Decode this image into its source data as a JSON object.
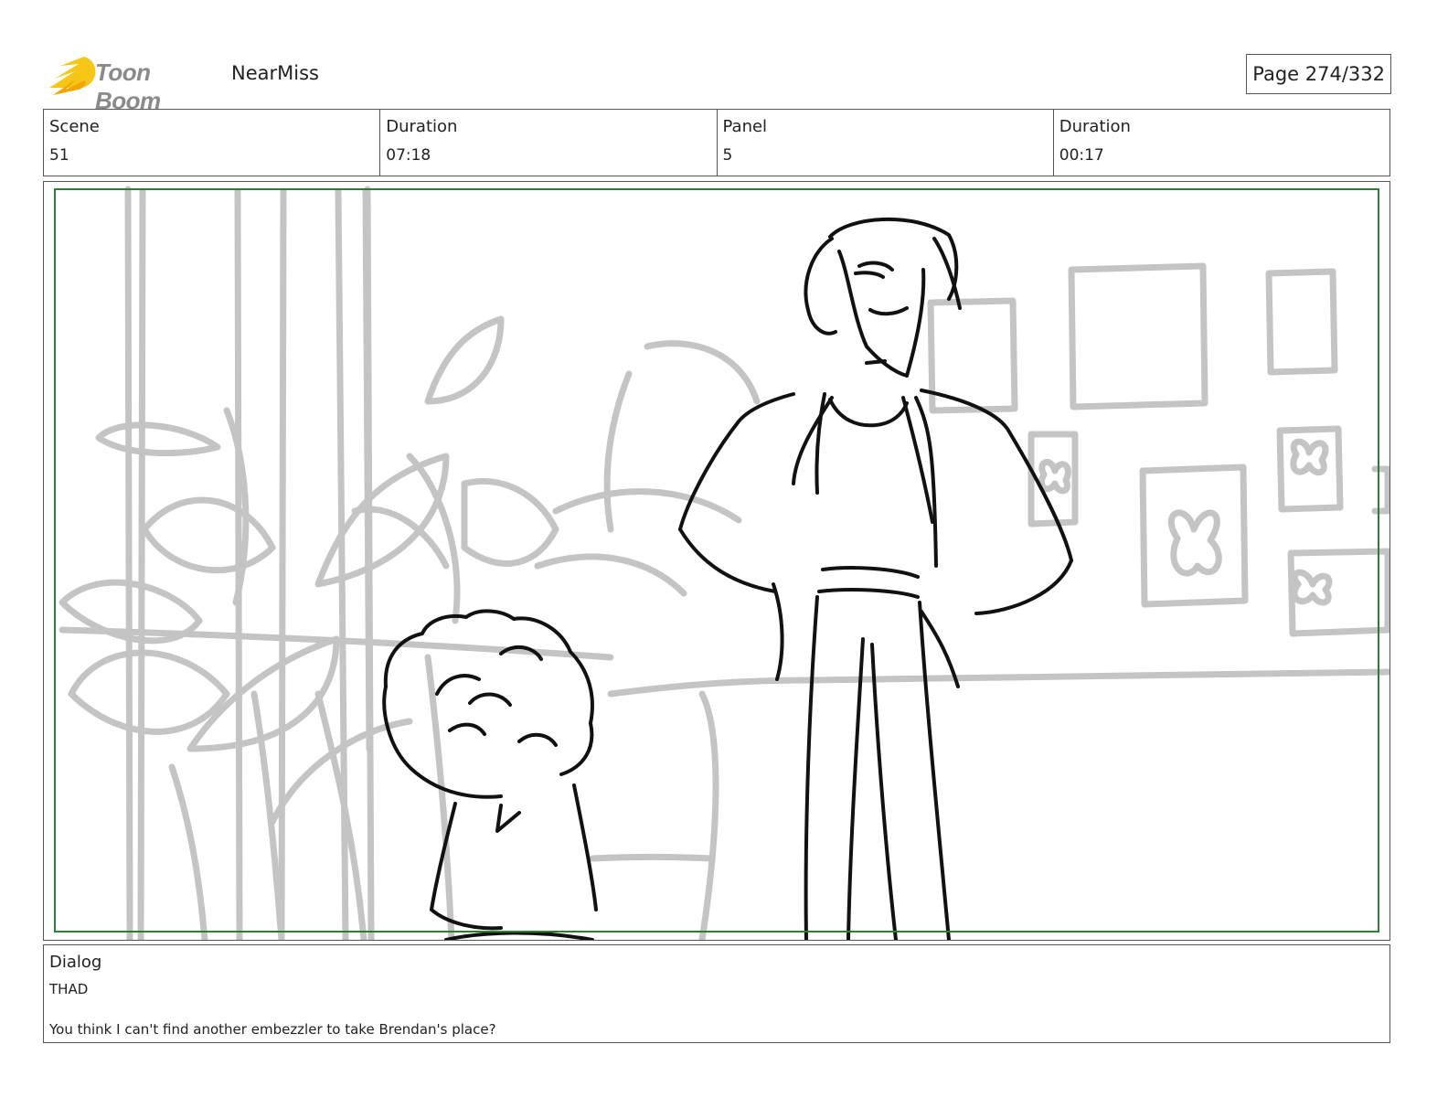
{
  "header": {
    "brand": "Toon Boom",
    "project": "NearMiss",
    "page": "Page 274/332"
  },
  "info": {
    "scene_label": "Scene",
    "scene_value": "51",
    "scene_duration_label": "Duration",
    "scene_duration_value": "07:18",
    "panel_label": "Panel",
    "panel_value": "5",
    "panel_duration_label": "Duration",
    "panel_duration_value": "00:17"
  },
  "dialog": {
    "label": "Dialog",
    "speaker": "THAD",
    "line": "You think I can't find another embezzler to take Brendan's place?"
  },
  "colors": {
    "safe_frame": "#2e7d32",
    "sketch_background": "#c4c4c4",
    "sketch_foreground": "#111111",
    "logo_flame": "#f5c518"
  }
}
